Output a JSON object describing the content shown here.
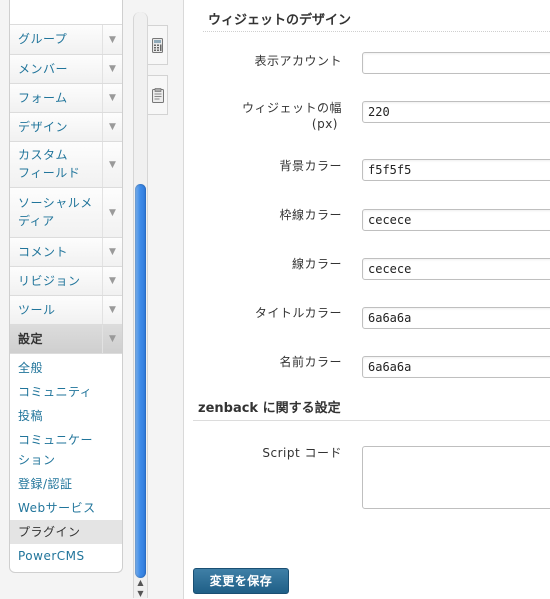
{
  "sidebar": {
    "nav": [
      {
        "label": "グループ"
      },
      {
        "label": "メンバー"
      },
      {
        "label": "フォーム"
      },
      {
        "label": "デザイン"
      },
      {
        "label_line1": "カスタム",
        "label_line2": "フィールド"
      },
      {
        "label_line1": "ソーシャルメ",
        "label_line2": "ディア"
      },
      {
        "label": "コメント"
      },
      {
        "label": "リビジョン"
      },
      {
        "label": "ツール"
      },
      {
        "label": "設定"
      }
    ],
    "sub": [
      {
        "label": "全般"
      },
      {
        "label": "コミュニティ"
      },
      {
        "label": "投稿"
      },
      {
        "label_line1": "コミュニケー",
        "label_line2": "ション"
      },
      {
        "label": "登録/認証"
      },
      {
        "label": "Webサービス"
      },
      {
        "label": "プラグイン"
      },
      {
        "label": "PowerCMS"
      }
    ],
    "arrow_glyph": "▼"
  },
  "form": {
    "widget_section_title": "ウィジェットのデザイン",
    "fields": [
      {
        "label": "表示アカウント",
        "value": ""
      },
      {
        "label_line1": "ウィジェットの幅",
        "label_line2": "(px)",
        "value": "220"
      },
      {
        "label": "背景カラー",
        "value": "f5f5f5"
      },
      {
        "label": "枠線カラー",
        "value": "cecece"
      },
      {
        "label": "線カラー",
        "value": "cecece"
      },
      {
        "label": "タイトルカラー",
        "value": "6a6a6a"
      },
      {
        "label": "名前カラー",
        "value": "6a6a6a"
      }
    ],
    "zenback_section_title": "zenback に関する設定",
    "script_label": "Script コード",
    "script_value": "",
    "save_label": "変更を保存"
  },
  "colors": {
    "link": "#21759b",
    "save_button": "#2a6a92",
    "scroll_thumb": "#3f8ce8"
  }
}
